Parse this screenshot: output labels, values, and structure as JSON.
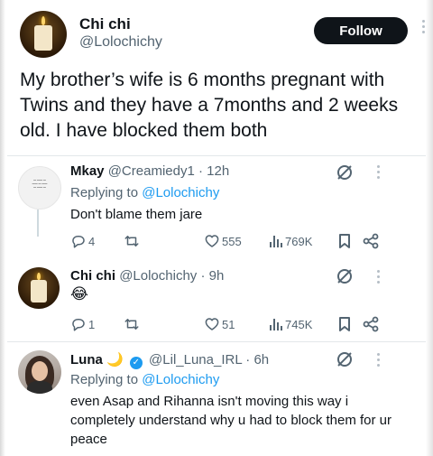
{
  "tweet": {
    "author_name": "Chi chi",
    "author_handle": "@Lolochichy",
    "follow_label": "Follow",
    "text": "My brother’s wife is 6 months pregnant with Twins and they have a 7months and 2 weeks old. I have blocked them both"
  },
  "replies": [
    {
      "name": "Mkay",
      "handle": "@Creamiedy1",
      "time": "· 12h",
      "replying_prefix": "Replying to",
      "replying_to": "@Lolochichy",
      "body": "Don't blame them jare",
      "stats": {
        "replies": "4",
        "retweets": "",
        "likes": "555",
        "views": "769K"
      }
    },
    {
      "name": "Chi chi",
      "handle": "@Lolochichy",
      "time": "· 9h",
      "body": "😂",
      "stats": {
        "replies": "1",
        "retweets": "",
        "likes": "51",
        "views": "745K"
      }
    },
    {
      "name": "Luna",
      "name_emoji": "🌙",
      "handle": "@Lil_Luna_IRL",
      "time": "· 6h",
      "replying_prefix": "Replying to",
      "replying_to": "@Lolochichy",
      "body": "even Asap and Rihanna isn't moving this way i completely understand why u had to block them for ur peace"
    }
  ],
  "icons": {
    "reply": "reply-icon",
    "retweet": "retweet-icon",
    "like": "heart-icon",
    "views": "views-icon",
    "bookmark": "bookmark-icon",
    "share": "share-icon",
    "grok": "grok-icon",
    "more": "more-icon",
    "verified": "verified-badge-icon"
  },
  "colors": {
    "text": "#0f1419",
    "secondary": "#536471",
    "link": "#1d9bf0",
    "follow_bg": "#0f1419"
  }
}
